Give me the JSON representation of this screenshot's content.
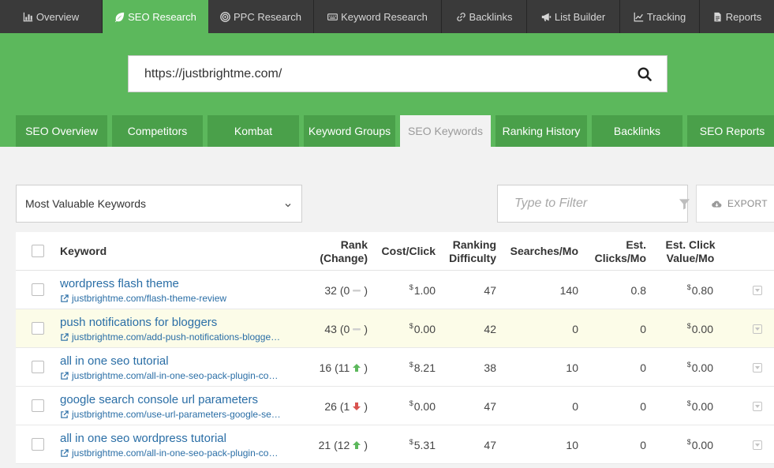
{
  "topnav": [
    {
      "label": "Overview",
      "icon": "bar-chart-icon",
      "active": false
    },
    {
      "label": "SEO Research",
      "icon": "leaf-icon",
      "active": true
    },
    {
      "label": "PPC Research",
      "icon": "target-icon",
      "active": false
    },
    {
      "label": "Keyword Research",
      "icon": "keyboard-icon",
      "active": false
    },
    {
      "label": "Backlinks",
      "icon": "link-icon",
      "active": false
    },
    {
      "label": "List Builder",
      "icon": "megaphone-icon",
      "active": false
    },
    {
      "label": "Tracking",
      "icon": "line-chart-icon",
      "active": false
    },
    {
      "label": "Reports",
      "icon": "document-icon",
      "active": false
    }
  ],
  "search": {
    "value": "https://justbrightme.com/",
    "icon": "search-icon"
  },
  "subtabs": [
    {
      "label": "SEO Overview",
      "active": false
    },
    {
      "label": "Competitors",
      "active": false
    },
    {
      "label": "Kombat",
      "active": false
    },
    {
      "label": "Keyword Groups",
      "active": false
    },
    {
      "label": "SEO Keywords",
      "active": true
    },
    {
      "label": "Ranking History",
      "active": false
    },
    {
      "label": "Backlinks",
      "active": false
    },
    {
      "label": "SEO Reports",
      "active": false
    }
  ],
  "filters": {
    "view_select": "Most Valuable Keywords",
    "filter_placeholder": "Type to Filter",
    "export_label": "EXPORT"
  },
  "table": {
    "headers": {
      "keyword": "Keyword",
      "rank_1": "Rank",
      "rank_2": "(Change)",
      "cost": "Cost/Click",
      "diff_1": "Ranking",
      "diff_2": "Difficulty",
      "searches": "Searches/Mo",
      "clicks_1": "Est.",
      "clicks_2": "Clicks/Mo",
      "value_1": "Est. Click",
      "value_2": "Value/Mo"
    },
    "currency": "$",
    "rows": [
      {
        "keyword": "wordpress flash theme",
        "url": "justbrightme.com/flash-theme-review",
        "rank": "32",
        "change": "0",
        "trend": "none",
        "cost": "1.00",
        "difficulty": "47",
        "searches": "140",
        "clicks": "0.8",
        "value": "0.80",
        "highlight": false
      },
      {
        "keyword": "push notifications for bloggers",
        "url": "justbrightme.com/add-push-notifications-blogge…",
        "rank": "43",
        "change": "0",
        "trend": "none",
        "cost": "0.00",
        "difficulty": "42",
        "searches": "0",
        "clicks": "0",
        "value": "0.00",
        "highlight": true
      },
      {
        "keyword": "all in one seo tutorial",
        "url": "justbrightme.com/all-in-one-seo-pack-plugin-co…",
        "rank": "16",
        "change": "11",
        "trend": "up",
        "cost": "8.21",
        "difficulty": "38",
        "searches": "10",
        "clicks": "0",
        "value": "0.00",
        "highlight": false
      },
      {
        "keyword": "google search console url parameters",
        "url": "justbrightme.com/use-url-parameters-google-se…",
        "rank": "26",
        "change": "1",
        "trend": "down",
        "cost": "0.00",
        "difficulty": "47",
        "searches": "0",
        "clicks": "0",
        "value": "0.00",
        "highlight": false
      },
      {
        "keyword": "all in one seo wordpress tutorial",
        "url": "justbrightme.com/all-in-one-seo-pack-plugin-co…",
        "rank": "21",
        "change": "12",
        "trend": "up",
        "cost": "5.31",
        "difficulty": "47",
        "searches": "10",
        "clicks": "0",
        "value": "0.00",
        "highlight": false
      }
    ]
  },
  "colors": {
    "brand_green": "#5cb85c",
    "tab_green": "#4aa04a",
    "link_blue": "#2a6ea6",
    "trend_up": "#5cb85c",
    "trend_down": "#d9534f",
    "nav_dark": "#3a3a3a"
  }
}
